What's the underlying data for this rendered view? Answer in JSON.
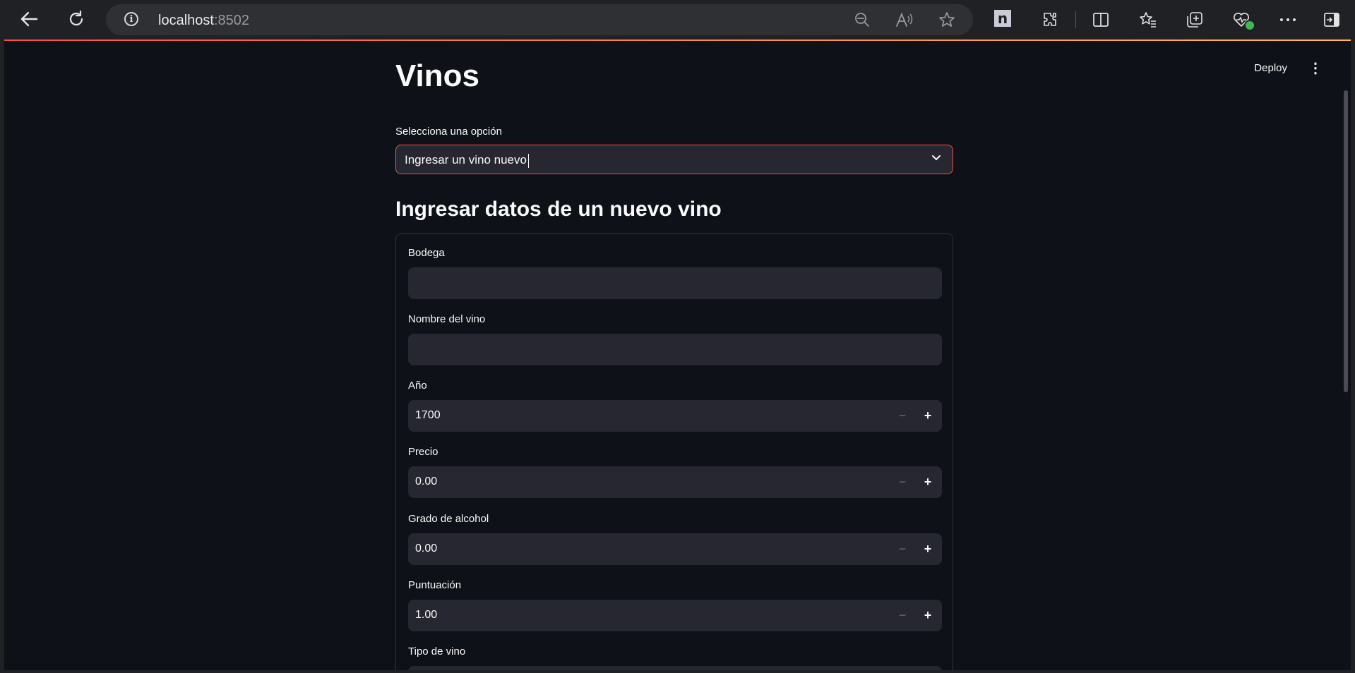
{
  "browser": {
    "url_host": "localhost",
    "url_port": ":8502",
    "icons": {
      "back": "back-arrow-icon",
      "reload": "reload-icon",
      "info": "site-info-icon",
      "zoom": "zoom-out-icon",
      "read_aloud": "read-aloud-icon",
      "favorite": "favorite-star-icon",
      "extension_n": "n",
      "extensions": "puzzle-icon",
      "split": "split-screen-icon",
      "favorites": "favorites-icon",
      "collections": "collections-icon",
      "health": "browser-essentials-icon",
      "more": "more-icon",
      "sidebar": "sidebar-icon"
    }
  },
  "app": {
    "header": {
      "deploy_label": "Deploy",
      "menu_glyph": "⋮"
    },
    "page_title": "Vinos",
    "select": {
      "label": "Selecciona una opción",
      "value": "Ingresar un vino nuevo"
    },
    "section_title": "Ingresar datos de un nuevo vino",
    "form": {
      "fields": [
        {
          "label": "Bodega",
          "type": "text",
          "value": ""
        },
        {
          "label": "Nombre del vino",
          "type": "text",
          "value": ""
        },
        {
          "label": "Año",
          "type": "number",
          "value": "1700"
        },
        {
          "label": "Precio",
          "type": "number",
          "value": "0.00"
        },
        {
          "label": "Grado de alcohol",
          "type": "number",
          "value": "0.00"
        },
        {
          "label": "Puntuación",
          "type": "number",
          "value": "1.00"
        },
        {
          "label": "Tipo de vino",
          "type": "select",
          "value": ""
        }
      ],
      "minus_glyph": "−",
      "plus_glyph": "+"
    }
  },
  "colors": {
    "app_bg": "#0e1117",
    "input_bg": "#262730",
    "accent": "#ff4b4b",
    "text": "#fafafa"
  }
}
